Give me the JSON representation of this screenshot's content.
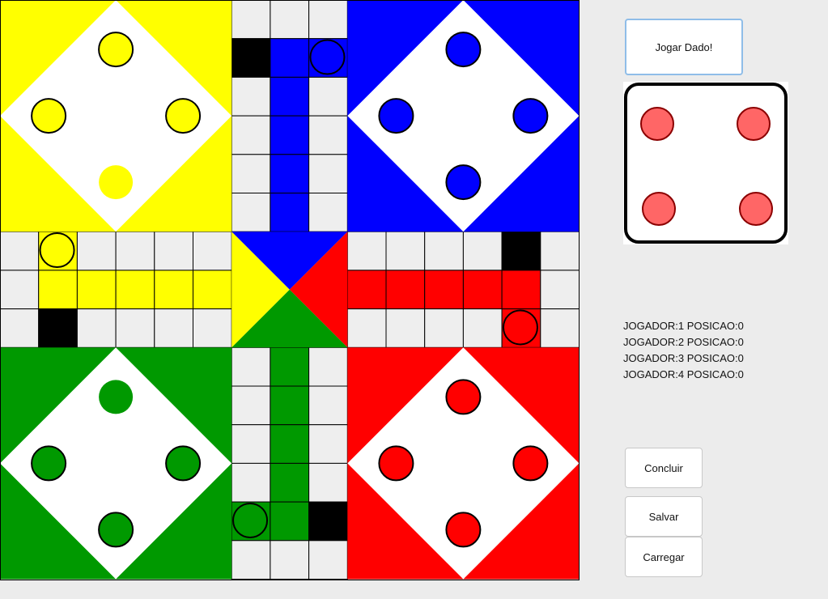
{
  "board": {
    "colors": {
      "yellow": "#ffff00",
      "blue": "#0000ff",
      "red": "#ff0000",
      "green": "#009900",
      "safe": "#000000",
      "track": "#eeeeee",
      "grid": "#000000"
    },
    "homes": [
      "yellow",
      "blue",
      "green",
      "red"
    ],
    "tokens_in_play": [
      {
        "color": "blue",
        "cell": [
          1,
          8
        ]
      },
      {
        "color": "yellow",
        "cell": [
          6,
          1
        ]
      },
      {
        "color": "red",
        "cell": [
          8,
          13
        ]
      },
      {
        "color": "green",
        "cell": [
          13,
          6
        ]
      }
    ]
  },
  "controls": {
    "roll_button": "Jogar Dado!",
    "conclude_button": "Concluir",
    "save_button": "Salvar",
    "load_button": "Carregar"
  },
  "die": {
    "value": 4,
    "pip_color": "#ff6666",
    "pip_border": "#8b0000"
  },
  "status": [
    "JOGADOR:1 POSICAO:0",
    "JOGADOR:2 POSICAO:0",
    "JOGADOR:3 POSICAO:0",
    "JOGADOR:4 POSICAO:0"
  ]
}
